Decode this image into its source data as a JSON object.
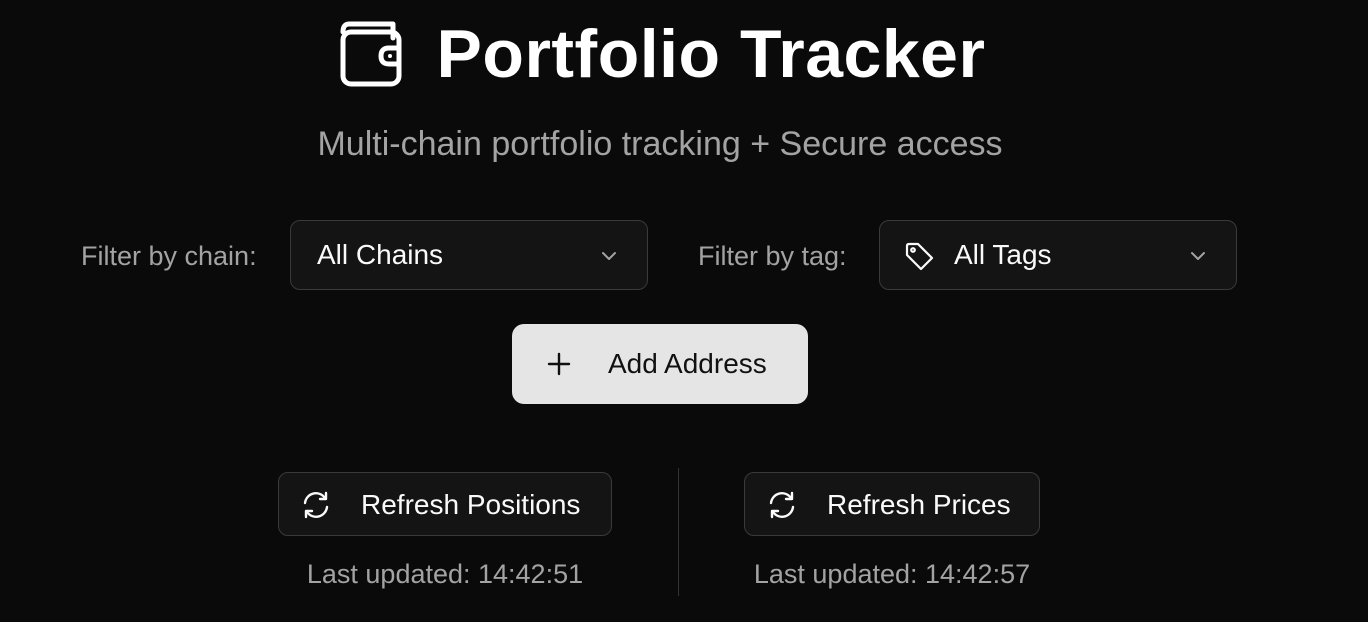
{
  "header": {
    "title": "Portfolio Tracker",
    "subtitle": "Multi-chain portfolio tracking + Secure access",
    "icon": "wallet-icon"
  },
  "filters": {
    "chain": {
      "label": "Filter by chain:",
      "value": "All Chains"
    },
    "tag": {
      "label": "Filter by tag:",
      "value": "All Tags",
      "icon": "tag-icon"
    }
  },
  "actions": {
    "add_address": "Add Address",
    "refresh_positions": {
      "label": "Refresh Positions",
      "last_updated": "Last updated: 14:42:51"
    },
    "refresh_prices": {
      "label": "Refresh Prices",
      "last_updated": "Last updated: 14:42:57"
    }
  },
  "colors": {
    "background": "#0a0a0a",
    "muted_text": "#a3a3a3",
    "primary_button": "#e5e5e5",
    "border": "#3a3a3a"
  }
}
